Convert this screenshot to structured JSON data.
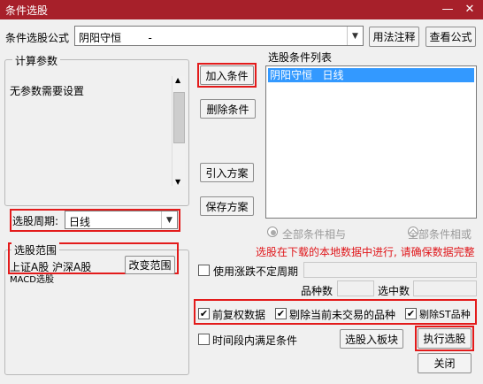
{
  "window": {
    "title": "条件选股",
    "minimize_glyph": "—",
    "close_glyph": "✕"
  },
  "formula": {
    "label": "条件选股公式",
    "value": "阴阳守恒        -",
    "usage_button": "用法注释",
    "view_button": "查看公式"
  },
  "params": {
    "group_title": "计算参数",
    "no_params_text": "无参数需要设置"
  },
  "buttons": {
    "add_condition": "加入条件",
    "delete_condition": "删除条件",
    "import_plan": "引入方案",
    "save_plan": "保存方案",
    "to_block": "选股入板块",
    "execute": "执行选股",
    "close": "关闭"
  },
  "condition_list": {
    "title": "选股条件列表",
    "items": [
      "阴阳守恒   日线"
    ]
  },
  "logic": {
    "all_and": "全部条件相与",
    "all_or": "全部条件相或",
    "selected": "all_and"
  },
  "period": {
    "label": "选股周期:",
    "value": "日线"
  },
  "note": "选股在下载的本地数据中进行, 请确保数据完整",
  "range": {
    "group_title": "选股范围",
    "markets": "上证A股 沪深A股",
    "change_button": "改变范围",
    "extra_text": "MACD选股"
  },
  "limit_period": {
    "label": "使用涨跌不定周期",
    "checked": false
  },
  "counts": {
    "total_label": "品种数",
    "selected_label": "选中数"
  },
  "options": {
    "adjusted": {
      "label": "前复权数据",
      "checked": true
    },
    "exclude_untraded": {
      "label": "剔除当前未交易的品种",
      "checked": true
    },
    "exclude_st": {
      "label": "剔除ST品种",
      "checked": true
    },
    "time_segment": {
      "label": "时间段内满足条件",
      "checked": false
    }
  },
  "colors": {
    "titlebar": "#a7202a",
    "list_selection": "#3399ff",
    "note_text": "#e0161a",
    "highlight": "#e31b1b"
  }
}
